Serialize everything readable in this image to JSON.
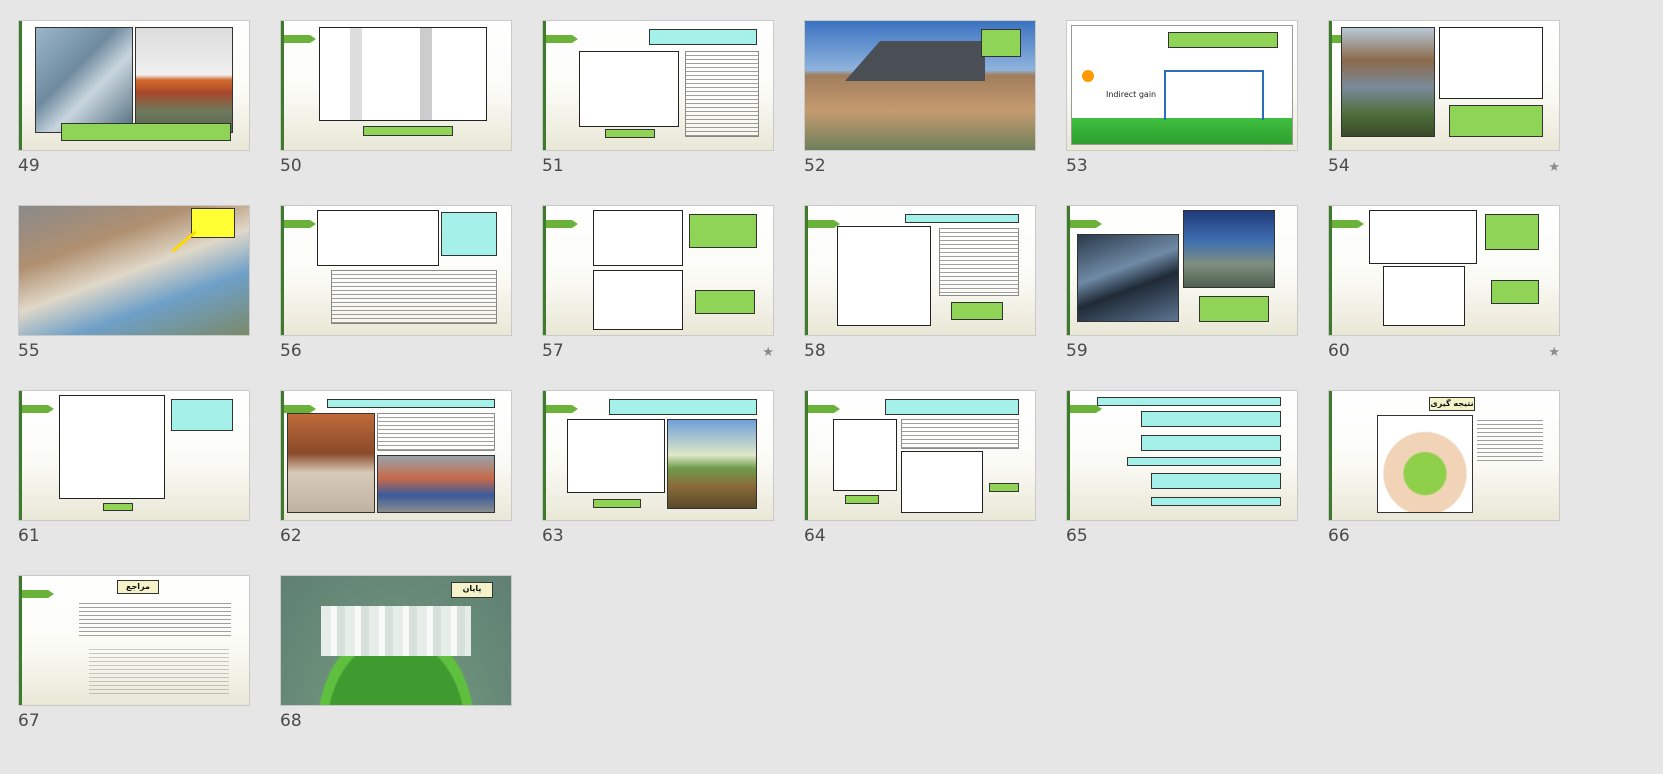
{
  "slides": [
    {
      "number": "49",
      "starred": false
    },
    {
      "number": "50",
      "starred": false
    },
    {
      "number": "51",
      "starred": false
    },
    {
      "number": "52",
      "starred": false
    },
    {
      "number": "53",
      "starred": false
    },
    {
      "number": "54",
      "starred": true
    },
    {
      "number": "55",
      "starred": false
    },
    {
      "number": "56",
      "starred": false
    },
    {
      "number": "57",
      "starred": true
    },
    {
      "number": "58",
      "starred": false
    },
    {
      "number": "59",
      "starred": false
    },
    {
      "number": "60",
      "starred": true
    },
    {
      "number": "61",
      "starred": false
    },
    {
      "number": "62",
      "starred": false
    },
    {
      "number": "63",
      "starred": false
    },
    {
      "number": "64",
      "starred": false
    },
    {
      "number": "65",
      "starred": false
    },
    {
      "number": "66",
      "starred": false
    },
    {
      "number": "67",
      "starred": false
    },
    {
      "number": "68",
      "starred": false
    }
  ],
  "slide53": {
    "diagram_label": "Indirect gain"
  },
  "slide66": {
    "title": "نتیجه گیری"
  },
  "slide67": {
    "title": "مراجع"
  },
  "slide68": {
    "title": "پایان"
  },
  "icons": {
    "star": "★"
  }
}
